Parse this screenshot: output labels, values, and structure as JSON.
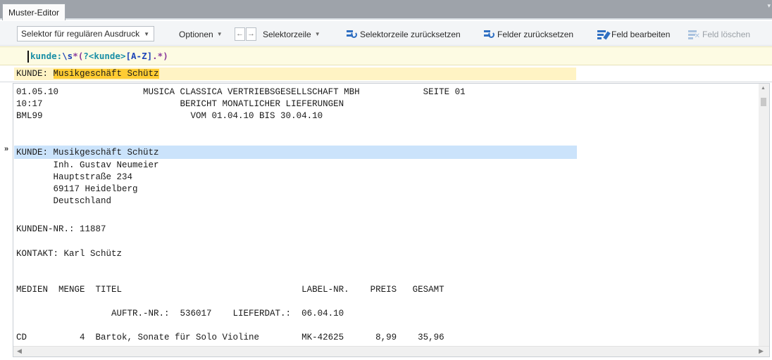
{
  "window": {
    "tab_title": "Muster-Editor"
  },
  "toolbar": {
    "selector_combo": "Selektor für regulären Ausdruck",
    "options": "Optionen",
    "prev_arrow": "←",
    "next_arrow": "→",
    "selector_line": "Selektorzeile",
    "reset_selector_line": "Selektorzeile zurücksetzen",
    "reset_fields": "Felder zurücksetzen",
    "edit_field": "Feld bearbeiten",
    "delete_field": "Feld löschen"
  },
  "regex": {
    "part1": "kunde:",
    "part2": "\\s",
    "part3": "*(",
    "part4": "?<kunde>",
    "part5": "[A-Z]",
    "part6": ".*)"
  },
  "result": {
    "prefix": "KUNDE: ",
    "match": "Musikgeschäft Schütz"
  },
  "document": {
    "lines": [
      "01.05.10                MUSICA CLASSICA VERTRIEBSGESELLSCHAFT MBH            SEITE 01",
      "10:17                          BERICHT MONATLICHER LIEFERUNGEN",
      "BML99                            VOM 01.04.10 BIS 30.04.10",
      "",
      "",
      "KUNDE: Musikgeschäft Schütz",
      "       Inh. Gustav Neumeier",
      "       Hauptstraße 234",
      "       69117 Heidelberg",
      "       Deutschland",
      "",
      "KUNDEN-NR.: 11887",
      "",
      "KONTAKT: Karl Schütz",
      "",
      "",
      "MEDIEN  MENGE  TITEL                                  LABEL-NR.    PREIS   GESAMT",
      "",
      "                  AUFTR.-NR.:  536017    LIEFERDAT.:  06.04.10",
      "",
      "CD          4  Bartok, Sonate für Solo Violine        MK-42625      8,99    35,96"
    ],
    "row_marker": "»"
  }
}
